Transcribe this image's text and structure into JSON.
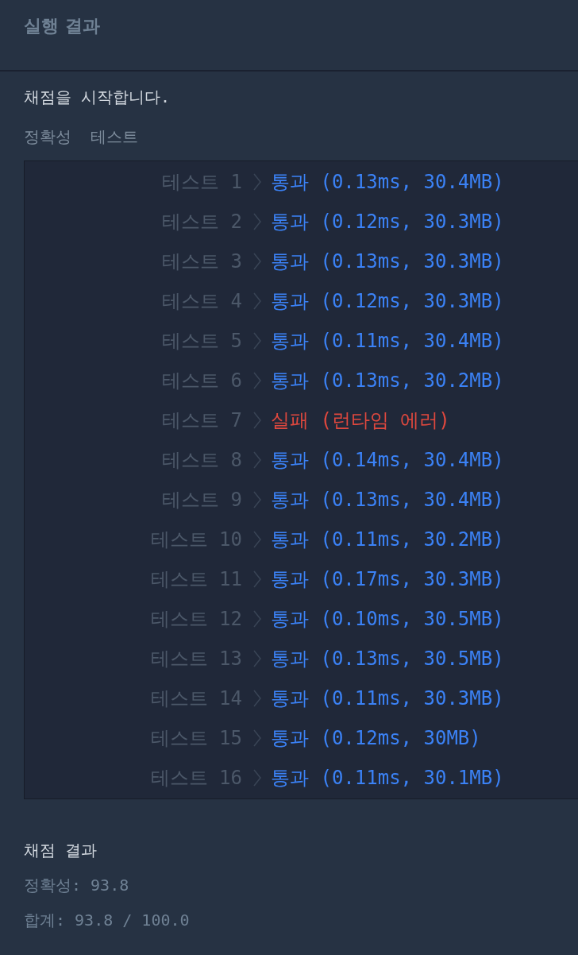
{
  "header": {
    "title": "실행 결과"
  },
  "console": {
    "start_message": "채점을 시작합니다.",
    "section_title": "정확성  테스트",
    "tests": [
      {
        "label": "테스트 1",
        "kind": "pass",
        "result": "통과 (0.13ms, 30.4MB)"
      },
      {
        "label": "테스트 2",
        "kind": "pass",
        "result": "통과 (0.12ms, 30.3MB)"
      },
      {
        "label": "테스트 3",
        "kind": "pass",
        "result": "통과 (0.13ms, 30.3MB)"
      },
      {
        "label": "테스트 4",
        "kind": "pass",
        "result": "통과 (0.12ms, 30.3MB)"
      },
      {
        "label": "테스트 5",
        "kind": "pass",
        "result": "통과 (0.11ms, 30.4MB)"
      },
      {
        "label": "테스트 6",
        "kind": "pass",
        "result": "통과 (0.13ms, 30.2MB)"
      },
      {
        "label": "테스트 7",
        "kind": "fail",
        "result": "실패 (런타임 에러)"
      },
      {
        "label": "테스트 8",
        "kind": "pass",
        "result": "통과 (0.14ms, 30.4MB)"
      },
      {
        "label": "테스트 9",
        "kind": "pass",
        "result": "통과 (0.13ms, 30.4MB)"
      },
      {
        "label": "테스트 10",
        "kind": "pass",
        "result": "통과 (0.11ms, 30.2MB)"
      },
      {
        "label": "테스트 11",
        "kind": "pass",
        "result": "통과 (0.17ms, 30.3MB)"
      },
      {
        "label": "테스트 12",
        "kind": "pass",
        "result": "통과 (0.10ms, 30.5MB)"
      },
      {
        "label": "테스트 13",
        "kind": "pass",
        "result": "통과 (0.13ms, 30.5MB)"
      },
      {
        "label": "테스트 14",
        "kind": "pass",
        "result": "통과 (0.11ms, 30.3MB)"
      },
      {
        "label": "테스트 15",
        "kind": "pass",
        "result": "통과 (0.12ms, 30MB)"
      },
      {
        "label": "테스트 16",
        "kind": "pass",
        "result": "통과 (0.11ms, 30.1MB)"
      }
    ],
    "summary_title": "채점 결과",
    "summary_lines": [
      "정확성: 93.8",
      "합계: 93.8 / 100.0"
    ]
  }
}
